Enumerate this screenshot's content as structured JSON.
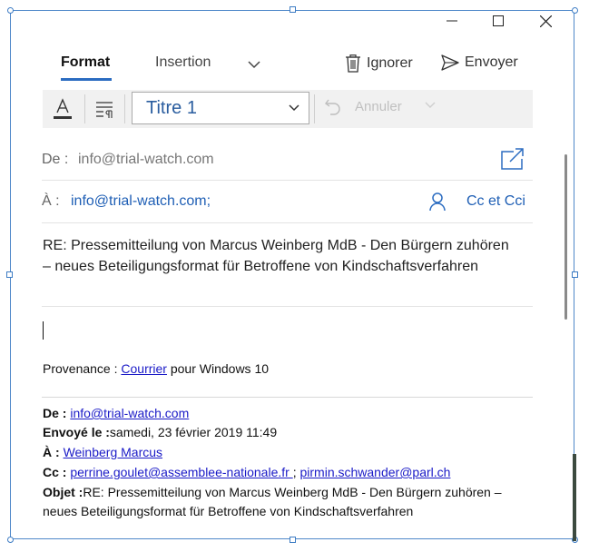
{
  "tabs": {
    "format": "Format",
    "insertion": "Insertion"
  },
  "actions": {
    "ignorer": "Ignorer",
    "envoyer": "Envoyer"
  },
  "toolbar": {
    "style_value": "Titre 1",
    "undo_label": "Annuler"
  },
  "from": {
    "label": "De :",
    "value": "info@trial-watch.com"
  },
  "to": {
    "label": "À :",
    "value": "info@trial-watch.com;",
    "cc_button": "Cc et Cci"
  },
  "subject": "RE: Pressemitteilung von Marcus Weinberg MdB -  Den Bürgern zuhören – neues Beteiligungsformat für Betroffene von Kindschaftsverfahren",
  "body": {
    "provenance_prefix": "Provenance : ",
    "provenance_link": "Courrier",
    "provenance_suffix": " pour Windows 10",
    "quoted": {
      "de_label": "De : ",
      "de_value": "info@trial-watch.com",
      "envoye_label": "Envoyé le :",
      "envoye_value": "samedi, 23 février 2019 11:49",
      "a_label": "À : ",
      "a_value": "Weinberg Marcus",
      "cc_label": "Cc : ",
      "cc_value1": "perrine.goulet@assemblee-nationale.fr ",
      "cc_sep": "; ",
      "cc_value2": "pirmin.schwander@parl.ch",
      "objet_label": "Objet :",
      "objet_value": "RE: Pressemitteilung von Marcus Weinberg MdB - Den Bürgern zuhören – neues Beteiligungsformat für Betroffene von Kindschaftsverfahren"
    }
  },
  "colors": {
    "accent": "#2b6cc1",
    "link": "#1a1ac7",
    "frame": "#4f88c9"
  },
  "icons": {
    "minimize": "minimize-icon",
    "maximize": "maximize-icon",
    "close": "close-icon",
    "trash": "trash-icon",
    "send": "send-icon",
    "popout": "popout-icon",
    "person": "person-icon"
  }
}
